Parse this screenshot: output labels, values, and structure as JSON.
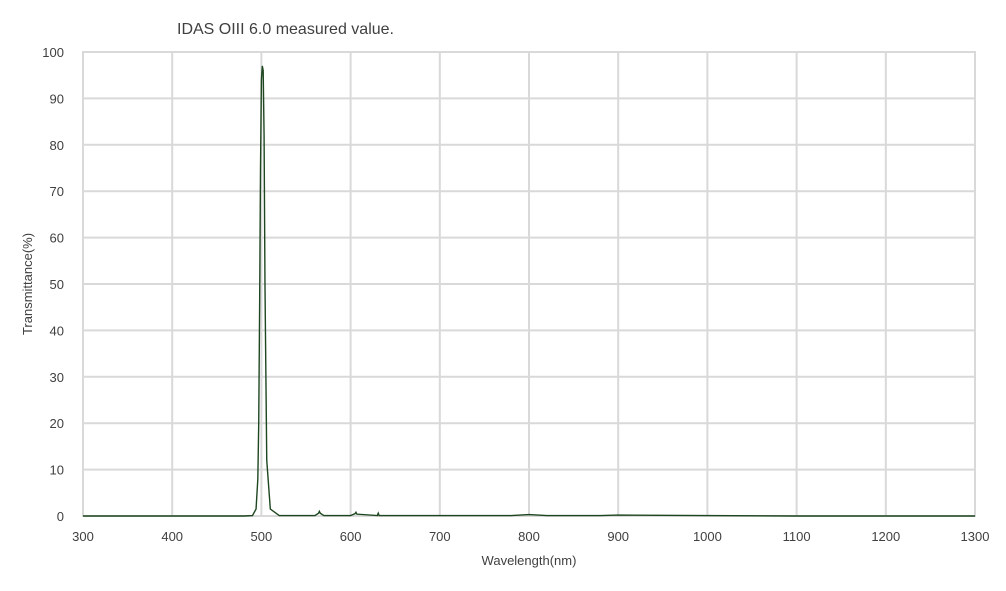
{
  "chart_data": {
    "type": "line",
    "title": "IDAS  OIII 6.0  measured value.",
    "xlabel": "Wavelength(nm)",
    "ylabel": "Transmittance(%)",
    "xlim": [
      300,
      1300
    ],
    "ylim": [
      0,
      100
    ],
    "xticks": [
      300,
      400,
      500,
      600,
      700,
      800,
      900,
      1000,
      1100,
      1200,
      1300
    ],
    "yticks": [
      0,
      10,
      20,
      30,
      40,
      50,
      60,
      70,
      80,
      90,
      100
    ],
    "grid": true,
    "legend": "none",
    "series_color": "#1e4620",
    "series": [
      {
        "x": [
          300,
          400,
          480,
          490,
          494,
          496,
          497,
          498,
          499,
          500,
          501,
          502,
          503,
          504,
          506,
          510,
          520,
          560,
          564,
          565,
          566,
          570,
          600,
          605,
          606,
          607,
          630,
          631,
          632,
          700,
          780,
          800,
          820,
          880,
          900,
          1000,
          1100,
          1200,
          1300
        ],
        "y": [
          0,
          0,
          0,
          0.1,
          1.5,
          8,
          20,
          45,
          75,
          94,
          97,
          96,
          82,
          50,
          12,
          1.5,
          0.1,
          0.1,
          0.6,
          1.0,
          0.6,
          0.1,
          0.1,
          0.5,
          0.8,
          0.4,
          0.1,
          0.6,
          0.1,
          0.1,
          0.1,
          0.3,
          0.1,
          0.1,
          0.2,
          0.1,
          0,
          0,
          0
        ]
      }
    ]
  }
}
